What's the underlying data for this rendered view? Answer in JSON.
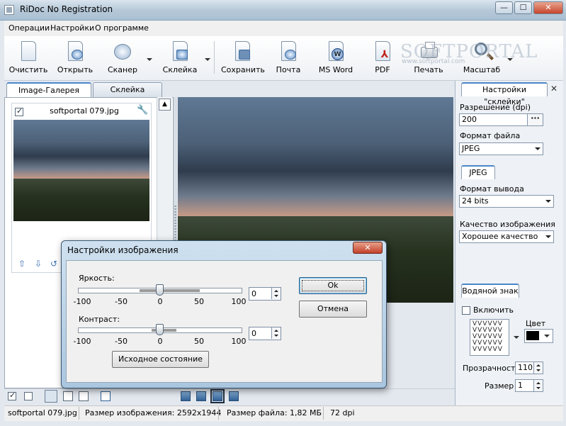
{
  "window": {
    "title": "RiDoc No Registration",
    "controls": {
      "minimize": "—",
      "maximize": "☐",
      "close": "✕"
    }
  },
  "menu": [
    "Операции",
    "Настройки",
    "О программе"
  ],
  "toolbar": {
    "clear": "Очистить",
    "open": "Открыть",
    "scanner": "Сканер",
    "collage": "Склейка",
    "save": "Сохранить",
    "mail": "Почта",
    "msword": "MS Word",
    "pdf": "PDF",
    "print": "Печать",
    "scale": "Масштаб"
  },
  "watermark": {
    "text": "SOFTPORTAL",
    "url": "www.softportal.com"
  },
  "tabs": {
    "gallery": "Image-Галерея",
    "collage": "Склейка"
  },
  "gallery": {
    "item": {
      "filename": "softportal 079.jpg",
      "checked": true
    }
  },
  "right_panel": {
    "tab": "Настройки \"склейки\"",
    "close": "✕",
    "resolution_label": "Разрешение (dpi)",
    "resolution_value": "200",
    "file_format_label": "Формат файла",
    "file_format_value": "JPEG",
    "jpeg_tab": "JPEG",
    "output_format_label": "Формат вывода",
    "output_format_value": "24 bits",
    "quality_label": "Качество изображения",
    "quality_value": "Хорошее качество",
    "watermark_tab": "Водяной знак",
    "enable_label": "Включить",
    "enable_checked": false,
    "pattern": "VVVVVV\nVVVVVV\nVVVVVV\nVVVVVV\nVVVVVV",
    "color_label": "Цвет",
    "color_value": "#000000",
    "transparency_label": "Прозрачность",
    "transparency_value": "110",
    "size_label": "Размер",
    "size_value": "1"
  },
  "dialog": {
    "title": "Настройки изображения",
    "close": "✕",
    "brightness_label": "Яркость:",
    "brightness_value": "0",
    "contrast_label": "Контраст:",
    "contrast_value": "0",
    "scale_ticks": [
      "-100",
      "-50",
      "0",
      "50",
      "100"
    ],
    "slider_min": -100,
    "slider_max": 100,
    "ok": "Ok",
    "cancel": "Отмена",
    "reset": "Исходное состояние"
  },
  "status": {
    "filename": "softportal 079.jpg",
    "image_size": "Размер изображения: 2592x1944",
    "file_size": "Размер файла: 1,82 МБ",
    "dpi": "72 dpi"
  },
  "colors": {
    "accent": "#4a86c8",
    "titlebar": "#b7c9d9",
    "close_button": "#c7442c"
  }
}
